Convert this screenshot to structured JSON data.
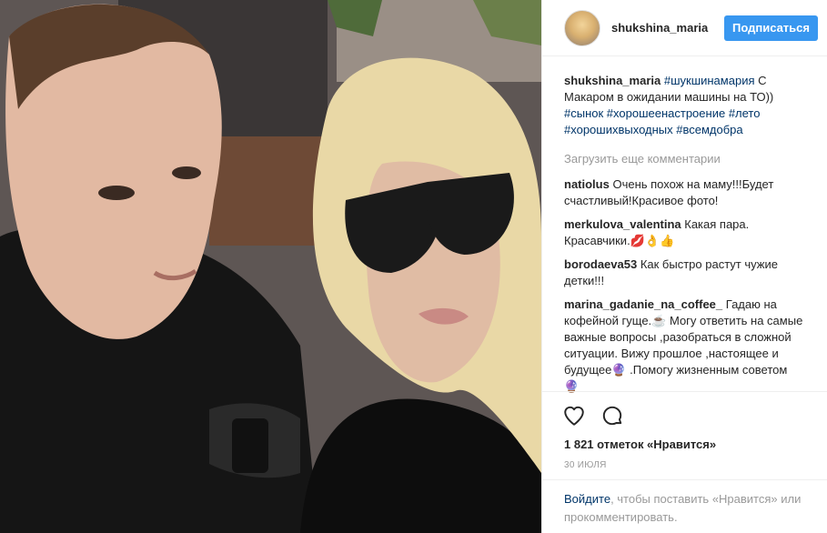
{
  "post": {
    "username": "shukshina_maria",
    "follow_label": "Подписаться",
    "caption": {
      "user": "shukshina_maria",
      "tag1": "#шукшинамария",
      "text1": " С Макаром в ожидании машины на ТО)) ",
      "tag2": "#сынок",
      "tag3": "#хорошеенастроение",
      "tag4": "#лето",
      "tag5": "#хорошихвыходных",
      "tag6": "#всемдобра"
    },
    "load_more": "Загрузить еще комментарии",
    "comments": [
      {
        "user": "natiolus",
        "text": "Очень похож на маму!!!Будет счастливый!Красивое фото!"
      },
      {
        "user": "merkulova_valentina",
        "text": "Какая пара. Красавчики.💋👌👍"
      },
      {
        "user": "borodaeva53",
        "text": "Как быстро растут чужие детки!!!"
      },
      {
        "user": "marina_gadanie_na_coffee_",
        "text": "Гадаю на кофейной гуще.☕ Могу ответить на самые важные вопросы ,разобраться в сложной ситуации. Вижу прошлое ,настоящее и будущее🔮 .Помогу жизненным советом 🔮"
      }
    ],
    "likes": "1 821 отметок «Нравится»",
    "date": "30 ИЮЛЯ",
    "login_link": "Войдите",
    "login_text": ", чтобы поставить «Нравится» или прокомментировать."
  },
  "icons": {
    "like": "heart-icon",
    "comment": "comment-bubble-icon"
  },
  "colors": {
    "accent": "#3897f0",
    "link": "#003569",
    "muted": "#999999"
  }
}
